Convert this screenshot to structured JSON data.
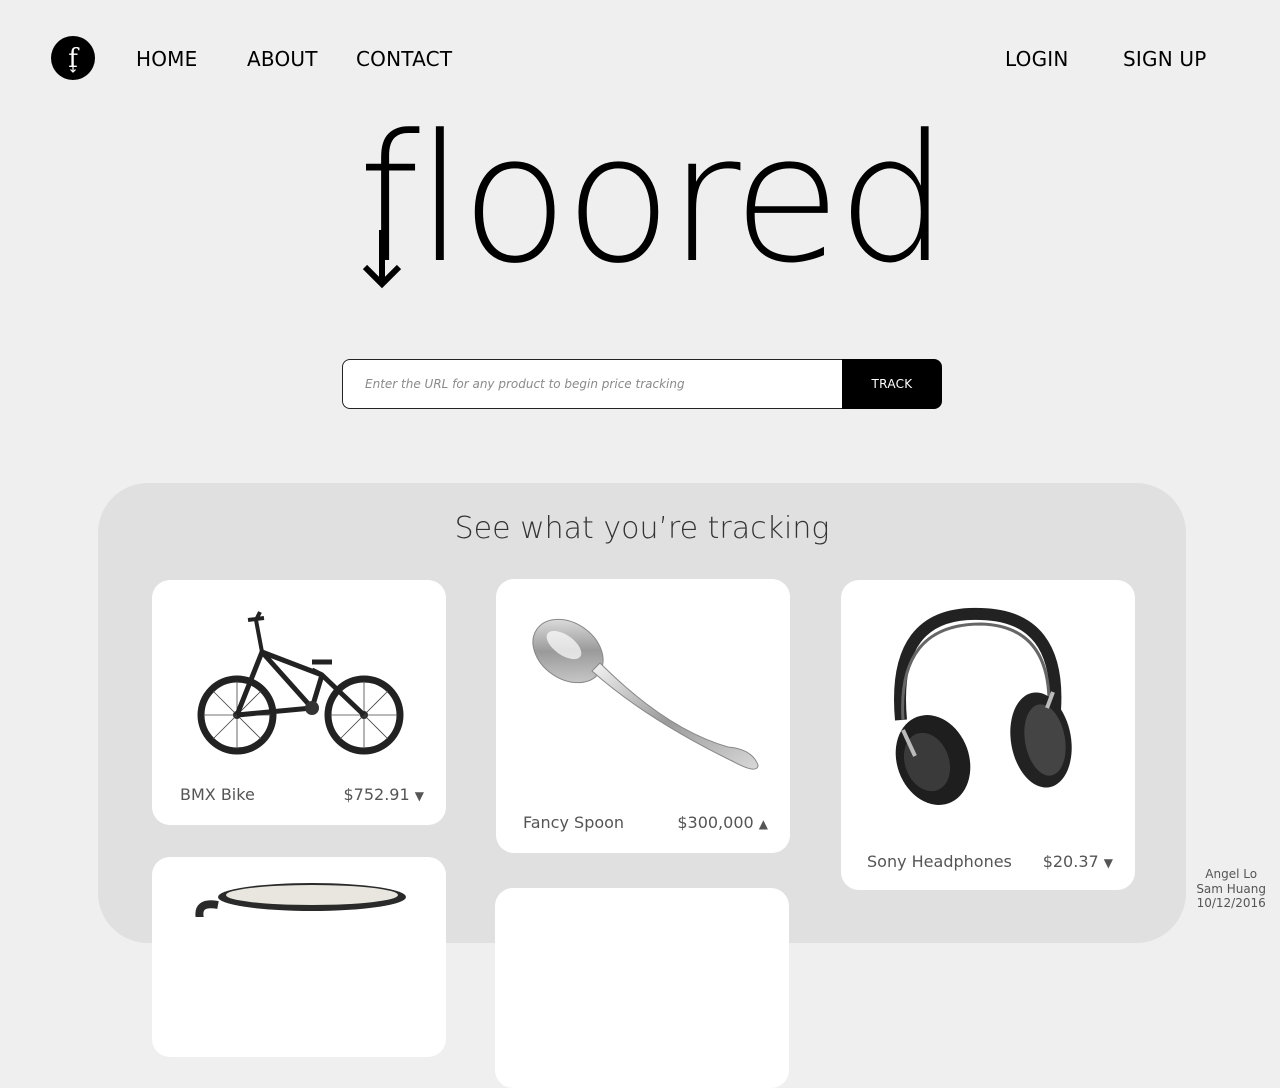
{
  "logo": {
    "letter": "f",
    "icon": "floored-logo-icon"
  },
  "nav": {
    "home": "HOME",
    "about": "ABOUT",
    "contact": "CONTACT",
    "login": "LOGIN",
    "signup": "SIGN UP"
  },
  "brand": {
    "wordmark": "floored"
  },
  "search": {
    "placeholder": "Enter the URL for any product to begin price tracking",
    "button": "TRACK"
  },
  "tracking": {
    "title": "See what you’re tracking",
    "items": [
      {
        "name": "BMX Bike",
        "price": "$752.91",
        "trend": "down",
        "arrow": "▼",
        "image": "bmx-bike-image"
      },
      {
        "name": "Fancy Spoon",
        "price": "$300,000",
        "trend": "up",
        "arrow": "▲",
        "image": "spoon-image"
      },
      {
        "name": "Sony Headphones",
        "price": "$20.37",
        "trend": "down",
        "arrow": "▼",
        "image": "headphones-image"
      }
    ]
  },
  "credits": {
    "line1": "Angel Lo",
    "line2": "Sam Huang",
    "line3": "10/12/2016"
  }
}
